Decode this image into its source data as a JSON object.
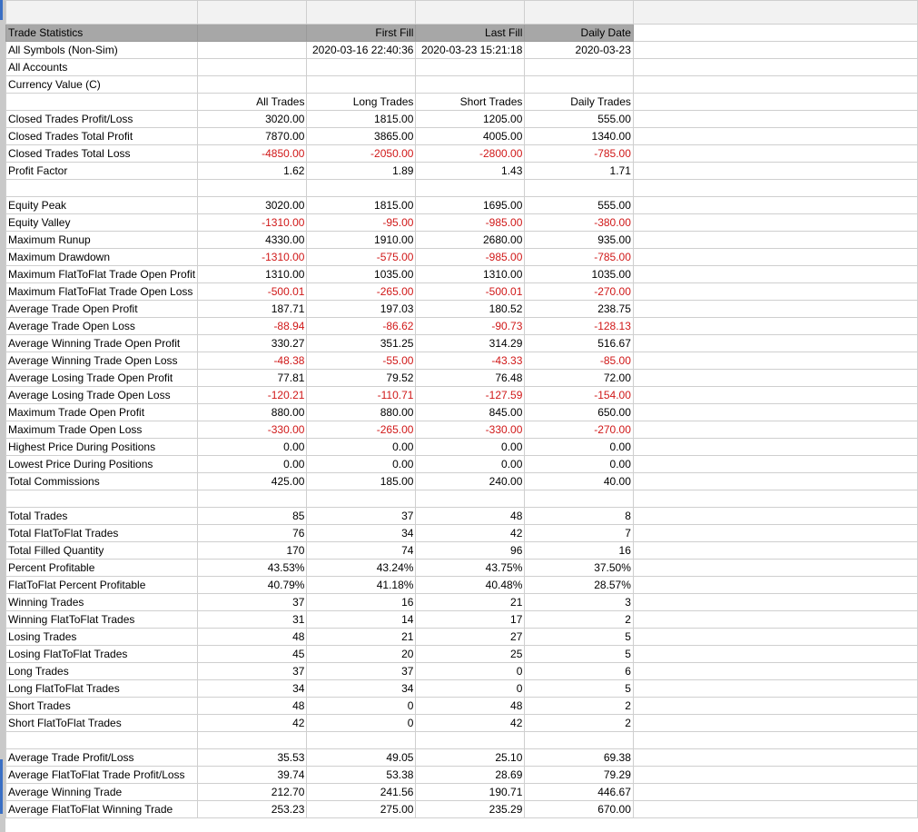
{
  "header": {
    "title": "Trade Statistics",
    "col1": "",
    "col2": "First Fill",
    "col3": "Last Fill",
    "col4": "Daily Date"
  },
  "info_rows": [
    {
      "label": "All Symbols (Non-Sim)",
      "c1": "",
      "c2": "2020-03-16  22:40:36",
      "c3": "2020-03-23  15:21:18",
      "c4": "2020-03-23"
    },
    {
      "label": "All Accounts",
      "c1": "",
      "c2": "",
      "c3": "",
      "c4": ""
    },
    {
      "label": "Currency Value (C)",
      "c1": "",
      "c2": "",
      "c3": "",
      "c4": ""
    }
  ],
  "column_headers": {
    "c1": "All Trades",
    "c2": "Long Trades",
    "c3": "Short Trades",
    "c4": "Daily Trades"
  },
  "sections": [
    {
      "rows": [
        {
          "label": "Closed Trades Profit/Loss",
          "values": [
            "3020.00",
            "1815.00",
            "1205.00",
            "555.00"
          ]
        },
        {
          "label": "Closed Trades Total Profit",
          "values": [
            "7870.00",
            "3865.00",
            "4005.00",
            "1340.00"
          ]
        },
        {
          "label": "Closed Trades Total Loss",
          "values": [
            "-4850.00",
            "-2050.00",
            "-2800.00",
            "-785.00"
          ]
        },
        {
          "label": "Profit Factor",
          "values": [
            "1.62",
            "1.89",
            "1.43",
            "1.71"
          ]
        }
      ]
    },
    {
      "rows": [
        {
          "label": "Equity Peak",
          "values": [
            "3020.00",
            "1815.00",
            "1695.00",
            "555.00"
          ]
        },
        {
          "label": "Equity Valley",
          "values": [
            "-1310.00",
            "-95.00",
            "-985.00",
            "-380.00"
          ]
        },
        {
          "label": "Maximum Runup",
          "values": [
            "4330.00",
            "1910.00",
            "2680.00",
            "935.00"
          ]
        },
        {
          "label": "Maximum Drawdown",
          "values": [
            "-1310.00",
            "-575.00",
            "-985.00",
            "-785.00"
          ]
        },
        {
          "label": "Maximum FlatToFlat Trade Open Profit",
          "values": [
            "1310.00",
            "1035.00",
            "1310.00",
            "1035.00"
          ]
        },
        {
          "label": "Maximum FlatToFlat Trade Open Loss",
          "values": [
            "-500.01",
            "-265.00",
            "-500.01",
            "-270.00"
          ]
        },
        {
          "label": "Average Trade Open Profit",
          "values": [
            "187.71",
            "197.03",
            "180.52",
            "238.75"
          ]
        },
        {
          "label": "Average Trade Open Loss",
          "values": [
            "-88.94",
            "-86.62",
            "-90.73",
            "-128.13"
          ]
        },
        {
          "label": "Average Winning Trade Open Profit",
          "values": [
            "330.27",
            "351.25",
            "314.29",
            "516.67"
          ]
        },
        {
          "label": "Average Winning Trade Open Loss",
          "values": [
            "-48.38",
            "-55.00",
            "-43.33",
            "-85.00"
          ]
        },
        {
          "label": "Average Losing Trade Open Profit",
          "values": [
            "77.81",
            "79.52",
            "76.48",
            "72.00"
          ]
        },
        {
          "label": "Average Losing Trade Open Loss",
          "values": [
            "-120.21",
            "-110.71",
            "-127.59",
            "-154.00"
          ]
        },
        {
          "label": "Maximum Trade Open Profit",
          "values": [
            "880.00",
            "880.00",
            "845.00",
            "650.00"
          ]
        },
        {
          "label": "Maximum Trade Open Loss",
          "values": [
            "-330.00",
            "-265.00",
            "-330.00",
            "-270.00"
          ]
        },
        {
          "label": "Highest Price During Positions",
          "values": [
            "0.00",
            "0.00",
            "0.00",
            "0.00"
          ]
        },
        {
          "label": "Lowest Price During Positions",
          "values": [
            "0.00",
            "0.00",
            "0.00",
            "0.00"
          ]
        },
        {
          "label": "Total Commissions",
          "values": [
            "425.00",
            "185.00",
            "240.00",
            "40.00"
          ]
        }
      ]
    },
    {
      "rows": [
        {
          "label": "Total Trades",
          "values": [
            "85",
            "37",
            "48",
            "8"
          ]
        },
        {
          "label": "Total FlatToFlat Trades",
          "values": [
            "76",
            "34",
            "42",
            "7"
          ]
        },
        {
          "label": "Total Filled Quantity",
          "values": [
            "170",
            "74",
            "96",
            "16"
          ]
        },
        {
          "label": "Percent Profitable",
          "values": [
            "43.53%",
            "43.24%",
            "43.75%",
            "37.50%"
          ]
        },
        {
          "label": "FlatToFlat Percent Profitable",
          "values": [
            "40.79%",
            "41.18%",
            "40.48%",
            "28.57%"
          ]
        },
        {
          "label": "Winning Trades",
          "values": [
            "37",
            "16",
            "21",
            "3"
          ]
        },
        {
          "label": "Winning FlatToFlat Trades",
          "values": [
            "31",
            "14",
            "17",
            "2"
          ]
        },
        {
          "label": "Losing Trades",
          "values": [
            "48",
            "21",
            "27",
            "5"
          ]
        },
        {
          "label": "Losing FlatToFlat Trades",
          "values": [
            "45",
            "20",
            "25",
            "5"
          ]
        },
        {
          "label": "Long Trades",
          "values": [
            "37",
            "37",
            "0",
            "6"
          ]
        },
        {
          "label": "Long FlatToFlat Trades",
          "values": [
            "34",
            "34",
            "0",
            "5"
          ]
        },
        {
          "label": "Short Trades",
          "values": [
            "48",
            "0",
            "48",
            "2"
          ]
        },
        {
          "label": "Short FlatToFlat Trades",
          "values": [
            "42",
            "0",
            "42",
            "2"
          ]
        }
      ]
    },
    {
      "rows": [
        {
          "label": "Average Trade Profit/Loss",
          "values": [
            "35.53",
            "49.05",
            "25.10",
            "69.38"
          ]
        },
        {
          "label": "Average FlatToFlat Trade Profit/Loss",
          "values": [
            "39.74",
            "53.38",
            "28.69",
            "79.29"
          ]
        },
        {
          "label": "Average Winning Trade",
          "values": [
            "212.70",
            "241.56",
            "190.71",
            "446.67"
          ]
        },
        {
          "label": "Average FlatToFlat Winning Trade",
          "values": [
            "253.23",
            "275.00",
            "235.29",
            "670.00"
          ]
        }
      ]
    }
  ],
  "colors": {
    "negative": "#d01818",
    "header_bg": "#a7a7a7",
    "grid_line": "#cfcfcf"
  }
}
